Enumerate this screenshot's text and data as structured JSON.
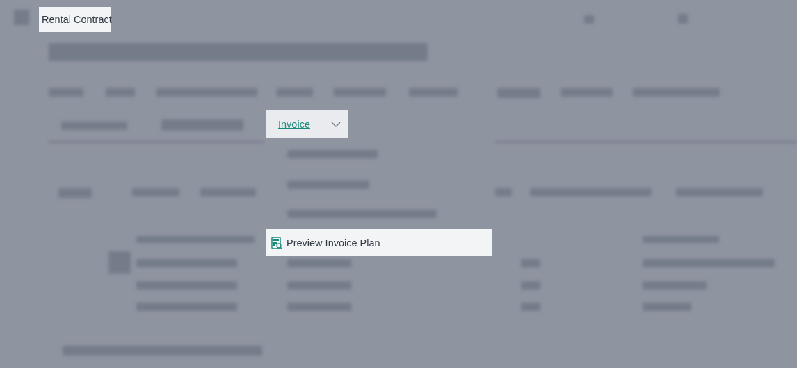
{
  "page_title": {
    "text": "Rental Contract"
  },
  "action_menu": {
    "label": "Invoice"
  },
  "highlighted_item": {
    "label": "Preview Invoice Plan"
  }
}
